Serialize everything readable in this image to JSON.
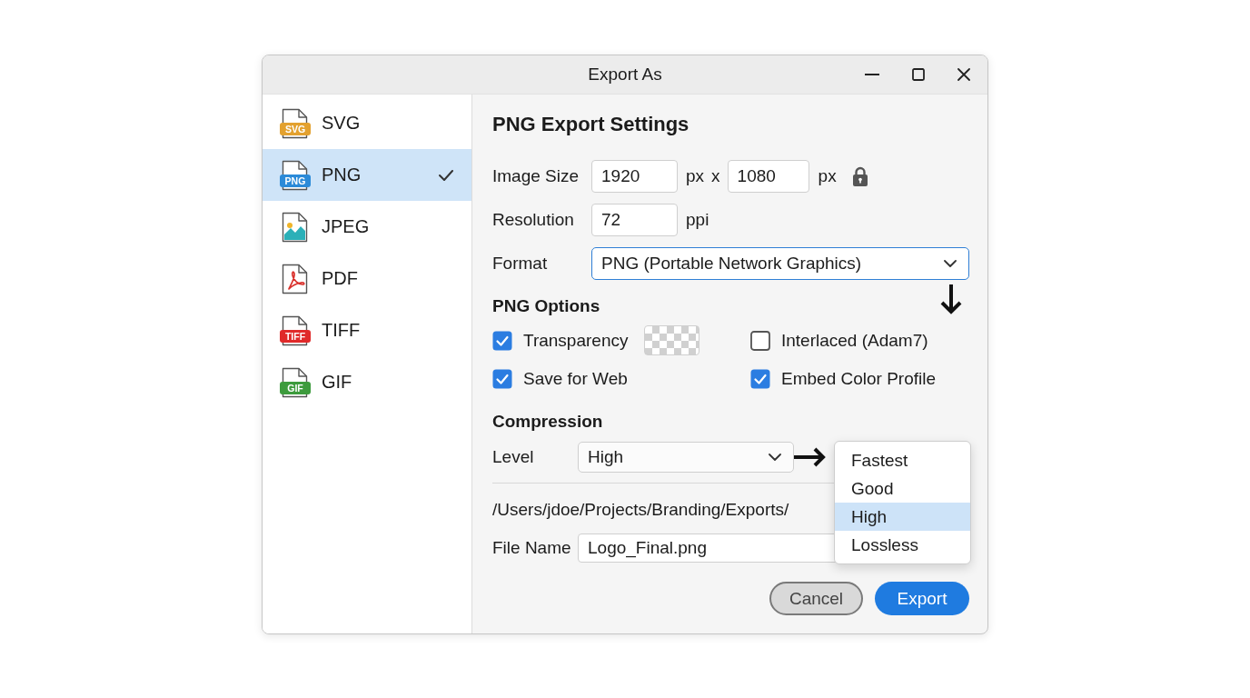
{
  "window": {
    "title": "Export As"
  },
  "formats": [
    {
      "label": "SVG",
      "kind": "badge",
      "badge": "SVG",
      "color": "#e3a12f",
      "selected": false
    },
    {
      "label": "PNG",
      "kind": "badge",
      "badge": "PNG",
      "color": "#2b8ad8",
      "selected": true
    },
    {
      "label": "JPEG",
      "kind": "image",
      "selected": false
    },
    {
      "label": "PDF",
      "kind": "pdf",
      "selected": false
    },
    {
      "label": "TIFF",
      "kind": "badge",
      "badge": "TIFF",
      "color": "#e02a2a",
      "selected": false
    },
    {
      "label": "GIF",
      "kind": "badge",
      "badge": "GIF",
      "color": "#3d9b3d",
      "selected": false
    }
  ],
  "settings": {
    "title": "PNG Export Settings",
    "image_size": {
      "label": "Image Size",
      "width": {
        "value": "1920",
        "unit": "px"
      },
      "separator": "x",
      "height": {
        "value": "1080",
        "unit": "px"
      },
      "locked": true
    },
    "resolution": {
      "label": "Resolution",
      "value": "72",
      "unit": "ppi"
    },
    "format": {
      "label": "Format",
      "value": "PNG (Portable Network Graphics)",
      "focused": true
    },
    "png_options": {
      "title": "PNG Options",
      "options": [
        {
          "label": "Transparency",
          "kind": "swatch",
          "checked": true
        },
        {
          "label": "Interlaced (Adam7)",
          "kind": "plain",
          "checked": false
        },
        {
          "label": "Save for Web",
          "kind": "plain",
          "checked": true
        },
        {
          "label": "Embed Color Profile",
          "kind": "plain",
          "checked": true
        }
      ]
    },
    "compression": {
      "title": "Compression",
      "level": {
        "label": "Level",
        "value": "High",
        "open": true,
        "options": [
          {
            "label": "Fastest",
            "selected": false
          },
          {
            "label": "Good",
            "selected": false
          },
          {
            "label": "High",
            "selected": true
          },
          {
            "label": "Lossless",
            "selected": false
          }
        ]
      }
    },
    "path": "/Users/jdoe/Projects/Branding/Exports/",
    "file_name": {
      "label": "File Name",
      "value": "Logo_Final.png"
    }
  },
  "buttons": [
    {
      "label": "Cancel",
      "kind": "secondary"
    },
    {
      "label": "Export",
      "kind": "primary"
    }
  ]
}
